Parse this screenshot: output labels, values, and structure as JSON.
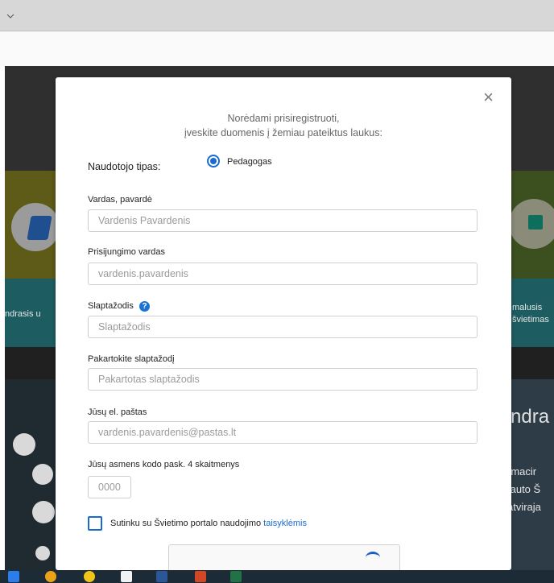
{
  "browser": {
    "chevron_icon": "chevron-down-icon"
  },
  "background": {
    "left_link_text": "ndrasis u",
    "right_link_line1": "malusis",
    "right_link_line2": "švietimas",
    "right_big_text": "ndra",
    "right_lines": [
      "rmacir",
      "tauto Š",
      "atviraja"
    ]
  },
  "modal": {
    "close_label": "×",
    "intro_line1": "Norėdami prisiregistruoti,",
    "intro_line2": "įveskite duomenis į žemiau pateiktus laukus:",
    "user_type_label": "Naudotojo tipas:",
    "user_type_option": "Pedagogas",
    "user_type_selected": true,
    "fields": {
      "full_name": {
        "label": "Vardas, pavardė",
        "placeholder": "Vardenis Pavardenis",
        "value": ""
      },
      "username": {
        "label": "Prisijungimo vardas",
        "placeholder": "vardenis.pavardenis",
        "value": ""
      },
      "password": {
        "label": "Slaptažodis",
        "placeholder": "Slaptažodis",
        "value": ""
      },
      "password_repeat": {
        "label": "Pakartokite slaptažodį",
        "placeholder": "Pakartotas slaptažodis",
        "value": ""
      },
      "email": {
        "label": "Jūsų el. paštas",
        "placeholder": "vardenis.pavardenis@pastas.lt",
        "value": ""
      },
      "personal_code": {
        "label": "Jūsų asmens kodo pask. 4 skaitmenys",
        "placeholder": "0000",
        "value": ""
      }
    },
    "help_icon": "?",
    "agree_text": "Sutinku su Švietimo portalo naudojimo ",
    "agree_link": "taisyklėmis",
    "agree_checked": false
  },
  "taskbar": {
    "icons": [
      "media-player-icon",
      "chrome-icon",
      "emoji-app-icon",
      "mail-icon",
      "word-icon",
      "powerpoint-icon",
      "excel-icon"
    ]
  },
  "colors": {
    "accent": "#1a6bd1",
    "taskbar": "#1c2b36"
  }
}
